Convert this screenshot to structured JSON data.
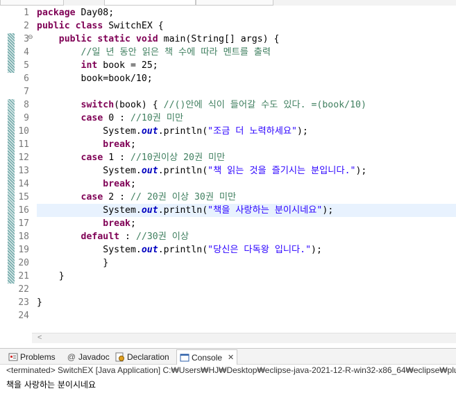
{
  "editor": {
    "lines": [
      {
        "n": "1",
        "parts": [
          {
            "c": "kw",
            "t": "package"
          },
          {
            "c": "",
            "t": " Day08;"
          }
        ]
      },
      {
        "n": "2",
        "parts": [
          {
            "c": "kw",
            "t": "public"
          },
          {
            "c": "",
            "t": " "
          },
          {
            "c": "kw",
            "t": "class"
          },
          {
            "c": "",
            "t": " SwitchEX {"
          }
        ]
      },
      {
        "n": "3",
        "parts": [
          {
            "c": "",
            "t": "    "
          },
          {
            "c": "kw",
            "t": "public"
          },
          {
            "c": "",
            "t": " "
          },
          {
            "c": "kw",
            "t": "static"
          },
          {
            "c": "",
            "t": " "
          },
          {
            "c": "kw",
            "t": "void"
          },
          {
            "c": "",
            "t": " main(String[] args) {"
          }
        ]
      },
      {
        "n": "4",
        "parts": [
          {
            "c": "",
            "t": "        "
          },
          {
            "c": "cm",
            "t": "//일 년 동안 읽은 책 수에 따라 멘트를 출력"
          }
        ]
      },
      {
        "n": "5",
        "parts": [
          {
            "c": "",
            "t": "        "
          },
          {
            "c": "kw",
            "t": "int"
          },
          {
            "c": "",
            "t": " book = 25;"
          }
        ]
      },
      {
        "n": "6",
        "parts": [
          {
            "c": "",
            "t": "        book=book/10;"
          }
        ]
      },
      {
        "n": "7",
        "parts": [
          {
            "c": "",
            "t": ""
          }
        ]
      },
      {
        "n": "8",
        "parts": [
          {
            "c": "",
            "t": "        "
          },
          {
            "c": "kw",
            "t": "switch"
          },
          {
            "c": "",
            "t": "(book) { "
          },
          {
            "c": "cm",
            "t": "//()안에 식이 들어갈 수도 있다. =(book/10)"
          }
        ]
      },
      {
        "n": "9",
        "parts": [
          {
            "c": "",
            "t": "        "
          },
          {
            "c": "kw",
            "t": "case"
          },
          {
            "c": "",
            "t": " 0 : "
          },
          {
            "c": "cm",
            "t": "//10권 미만"
          }
        ]
      },
      {
        "n": "10",
        "parts": [
          {
            "c": "",
            "t": "            System."
          },
          {
            "c": "fld",
            "t": "out"
          },
          {
            "c": "",
            "t": ".println("
          },
          {
            "c": "st",
            "t": "\"조금 더 노력하세요\""
          },
          {
            "c": "",
            "t": ");"
          }
        ]
      },
      {
        "n": "11",
        "parts": [
          {
            "c": "",
            "t": "            "
          },
          {
            "c": "kw",
            "t": "break"
          },
          {
            "c": "",
            "t": ";"
          }
        ]
      },
      {
        "n": "12",
        "parts": [
          {
            "c": "",
            "t": "        "
          },
          {
            "c": "kw",
            "t": "case"
          },
          {
            "c": "",
            "t": " 1 : "
          },
          {
            "c": "cm",
            "t": "//10권이상 20권 미만"
          }
        ]
      },
      {
        "n": "13",
        "parts": [
          {
            "c": "",
            "t": "            System."
          },
          {
            "c": "fld",
            "t": "out"
          },
          {
            "c": "",
            "t": ".println("
          },
          {
            "c": "st",
            "t": "\"책 읽는 것을 즐기시는 분입니다.\""
          },
          {
            "c": "",
            "t": ");"
          }
        ]
      },
      {
        "n": "14",
        "parts": [
          {
            "c": "",
            "t": "            "
          },
          {
            "c": "kw",
            "t": "break"
          },
          {
            "c": "",
            "t": ";"
          }
        ]
      },
      {
        "n": "15",
        "parts": [
          {
            "c": "",
            "t": "        "
          },
          {
            "c": "kw",
            "t": "case"
          },
          {
            "c": "",
            "t": " 2 : "
          },
          {
            "c": "cm",
            "t": "// 20권 이상 30권 미만"
          }
        ]
      },
      {
        "n": "16",
        "parts": [
          {
            "c": "",
            "t": "            System."
          },
          {
            "c": "fld",
            "t": "out"
          },
          {
            "c": "",
            "t": ".println("
          },
          {
            "c": "st",
            "t": "\"책을 사랑하는 분이시네요\""
          },
          {
            "c": "",
            "t": ");"
          }
        ]
      },
      {
        "n": "17",
        "parts": [
          {
            "c": "",
            "t": "            "
          },
          {
            "c": "kw",
            "t": "break"
          },
          {
            "c": "",
            "t": ";"
          }
        ]
      },
      {
        "n": "18",
        "parts": [
          {
            "c": "",
            "t": "        "
          },
          {
            "c": "kw",
            "t": "default"
          },
          {
            "c": "",
            "t": " : "
          },
          {
            "c": "cm",
            "t": "//30권 이상"
          }
        ]
      },
      {
        "n": "19",
        "parts": [
          {
            "c": "",
            "t": "            System."
          },
          {
            "c": "fld",
            "t": "out"
          },
          {
            "c": "",
            "t": ".println("
          },
          {
            "c": "st",
            "t": "\"당신은 다독왕 입니다.\""
          },
          {
            "c": "",
            "t": ");"
          }
        ]
      },
      {
        "n": "20",
        "parts": [
          {
            "c": "",
            "t": "            }"
          }
        ]
      },
      {
        "n": "21",
        "parts": [
          {
            "c": "",
            "t": "    }"
          }
        ]
      },
      {
        "n": "22",
        "parts": [
          {
            "c": "",
            "t": ""
          }
        ]
      },
      {
        "n": "23",
        "parts": [
          {
            "c": "",
            "t": "}"
          }
        ]
      },
      {
        "n": "24",
        "parts": [
          {
            "c": "",
            "t": ""
          }
        ]
      }
    ],
    "current_line": "16",
    "fold_marker": "⊖"
  },
  "panel": {
    "tabs": [
      {
        "label": "Problems",
        "icon": "problems-icon",
        "active": false
      },
      {
        "label": "Javadoc",
        "icon": "javadoc-icon",
        "active": false
      },
      {
        "label": "Declaration",
        "icon": "declaration-icon",
        "active": false
      },
      {
        "label": "Console",
        "icon": "console-icon",
        "active": true
      }
    ],
    "close_glyph": "✕",
    "status": "<terminated> SwitchEX [Java Application] C:₩Users₩HJ₩Desktop₩eclipse-java-2021-12-R-win32-x86_64₩eclipse₩plug",
    "output": "책을 사랑하는 분이시네요"
  },
  "colors": {
    "keyword": "#7f0055",
    "comment": "#3f7f5f",
    "string": "#2a00ff",
    "field": "#0000c0",
    "current_line": "#e8f2fe"
  }
}
